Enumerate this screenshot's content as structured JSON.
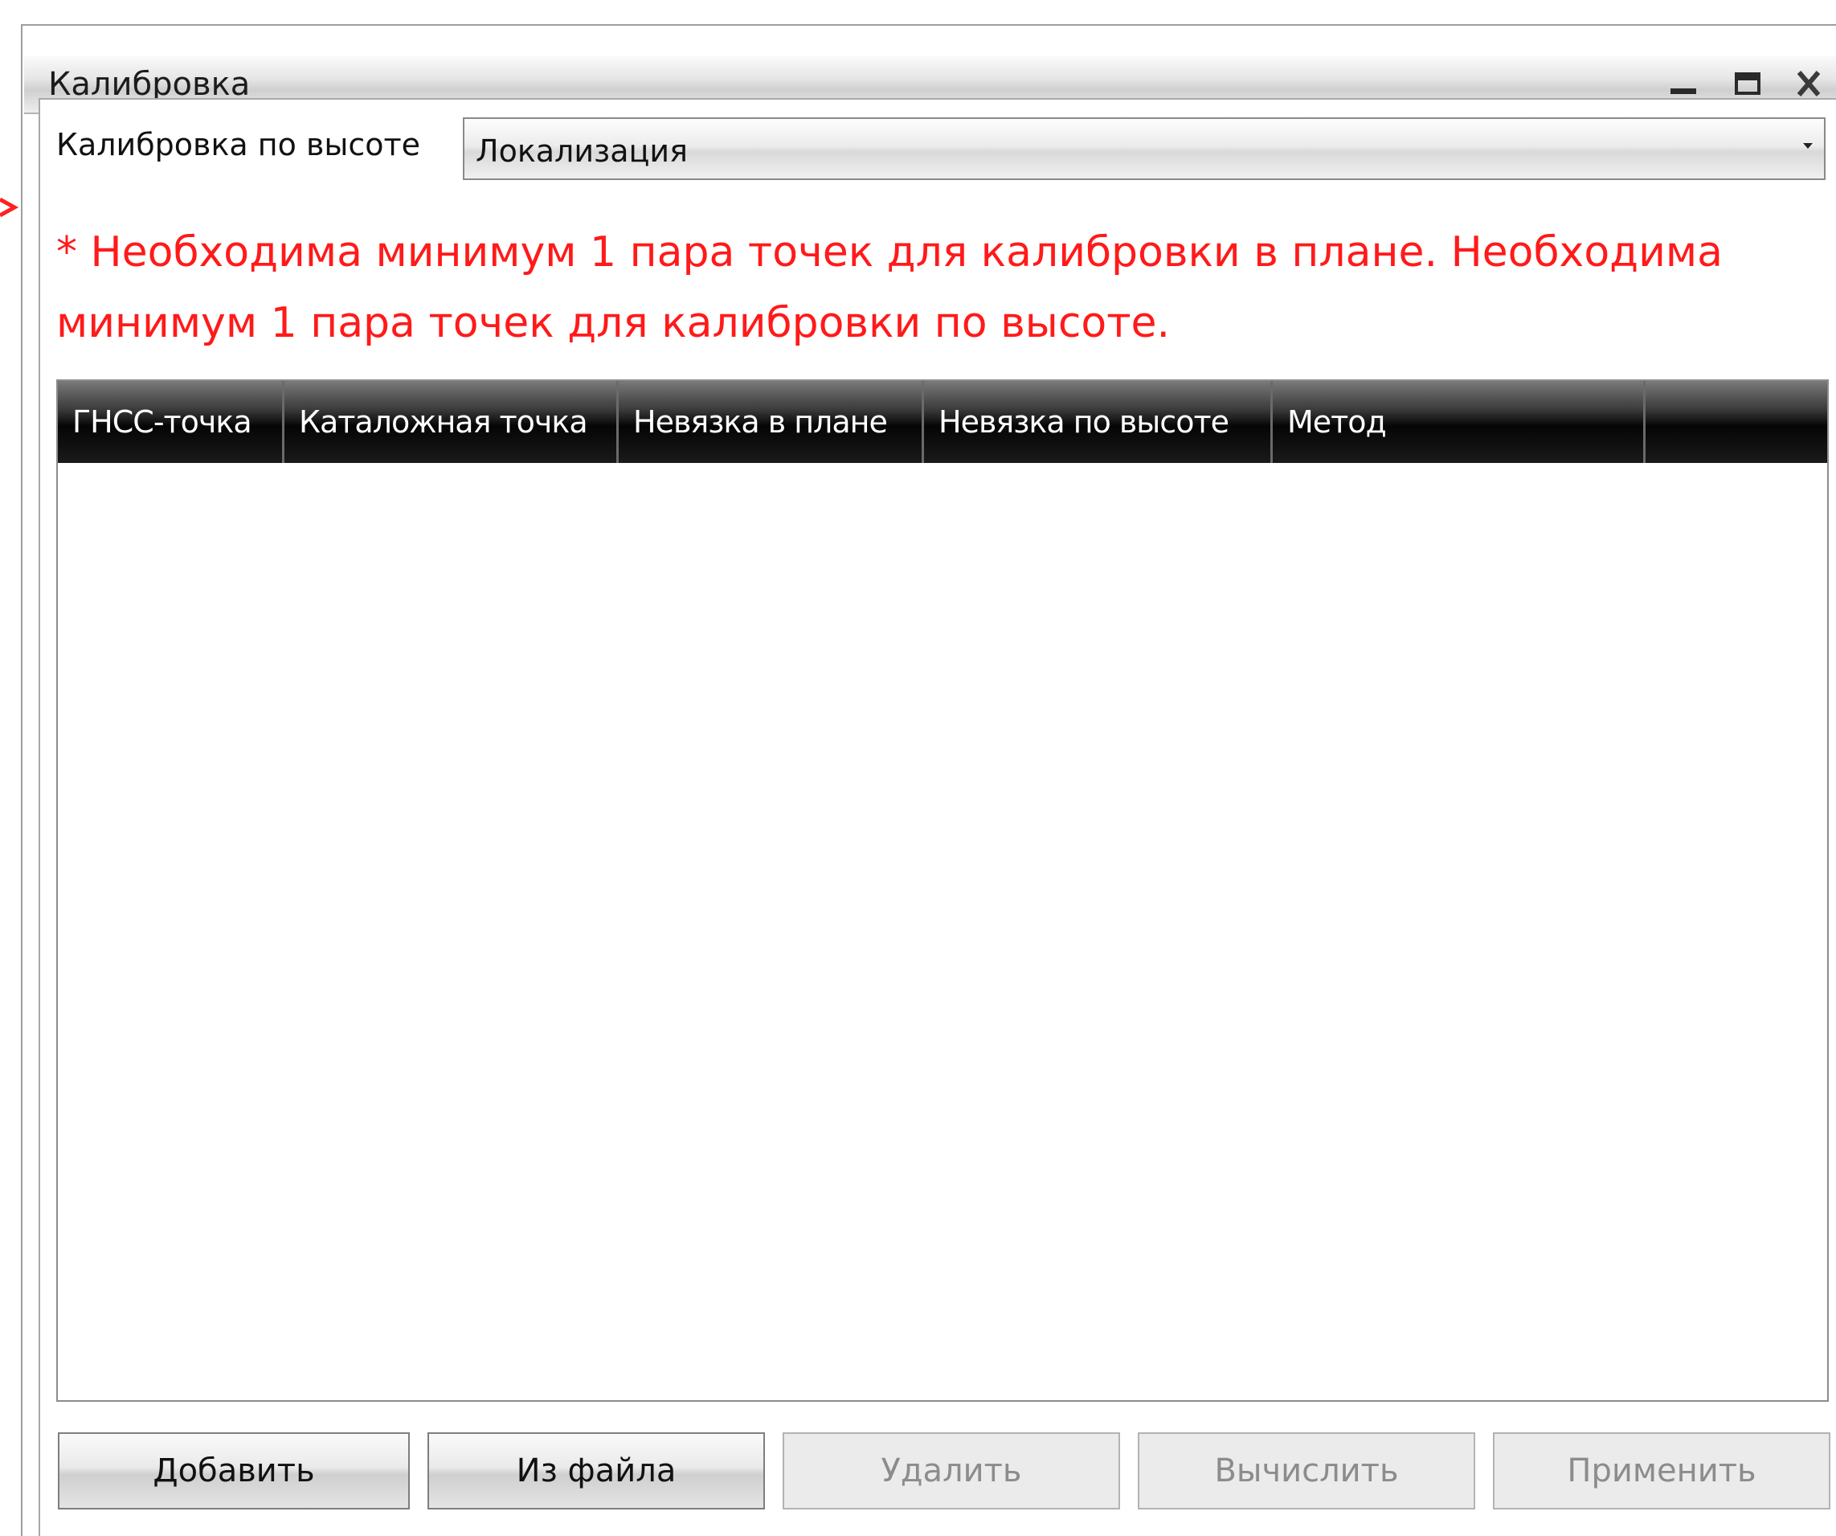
{
  "window": {
    "title": "Калибровка",
    "controls": {
      "minimize": "minimize-icon",
      "maximize": "maximize-icon",
      "close": "close-icon"
    }
  },
  "height_calibration": {
    "label": "Калибровка по высоте",
    "selected": "Локализация"
  },
  "warning": {
    "text": "* Необходима минимум 1 пара точек для калибровки в плане. Необходима минимум 1 пара точек для калибровки по высоте.",
    "color": "#ff1a1a"
  },
  "table": {
    "columns": [
      "ГНСС-точка",
      "Каталожная точка",
      "Невязка в плане",
      "Невязка по высоте",
      "Метод",
      ""
    ],
    "rows": []
  },
  "buttons": {
    "add": "Добавить",
    "from_file": "Из файла",
    "delete": "Удалить",
    "calculate": "Вычислить",
    "apply": "Применить"
  }
}
